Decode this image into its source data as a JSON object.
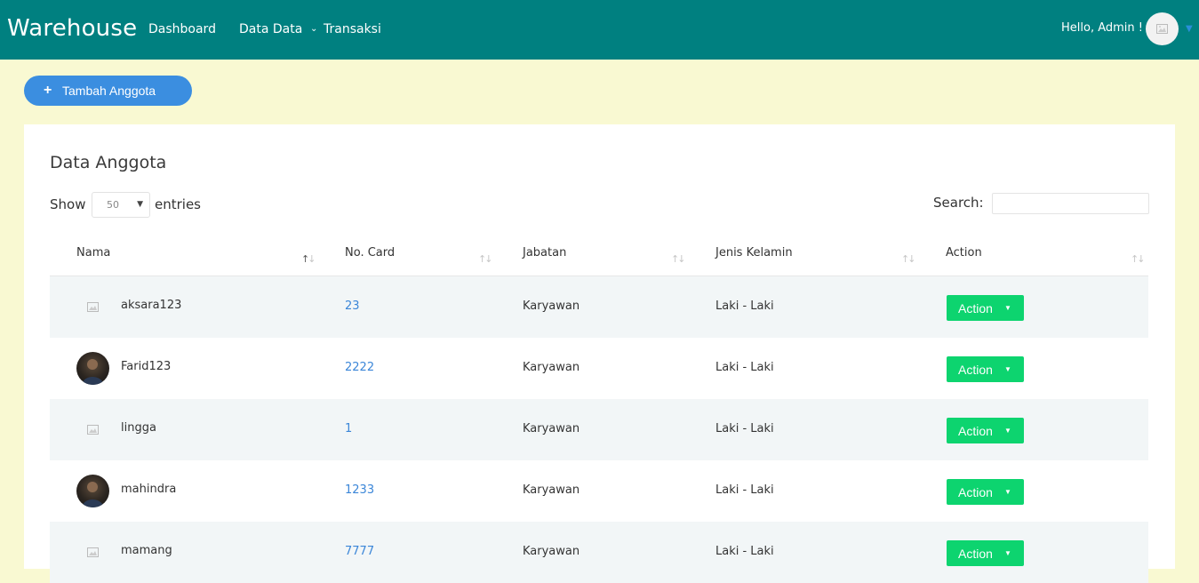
{
  "navbar": {
    "brand": "Warehouse",
    "links": [
      "Dashboard",
      "Data Data",
      "Transaksi"
    ],
    "greeting": "Hello, Admin !",
    "avatar_icon": "image-placeholder-icon",
    "bg_color": "#008080"
  },
  "toolbar": {
    "add_label": "Tambah Anggota",
    "add_icon": "plus-icon"
  },
  "card": {
    "title": "Data Anggota",
    "show_label": "Show",
    "page_size": "50",
    "entries_label": "entries",
    "search_label": "Search:",
    "search_value": ""
  },
  "table": {
    "columns": [
      "Nama",
      "No. Card",
      "Jabatan",
      "Jenis Kelamin",
      "Action"
    ],
    "sorted_column": "Nama",
    "rows": [
      {
        "nama": "aksara123",
        "card": "23",
        "jabatan": "Karyawan",
        "jk": "Laki - Laki",
        "action": "Action",
        "avatar": "image-placeholder-icon"
      },
      {
        "nama": "Farid123",
        "card": "2222",
        "jabatan": "Karyawan",
        "jk": "Laki - Laki",
        "action": "Action",
        "avatar": "user-photo"
      },
      {
        "nama": "lingga",
        "card": "1",
        "jabatan": "Karyawan",
        "jk": "Laki - Laki",
        "action": "Action",
        "avatar": "image-placeholder-icon"
      },
      {
        "nama": "mahindra",
        "card": "1233",
        "jabatan": "Karyawan",
        "jk": "Laki - Laki",
        "action": "Action",
        "avatar": "user-photo"
      },
      {
        "nama": "mamang",
        "card": "7777",
        "jabatan": "Karyawan",
        "jk": "Laki - Laki",
        "action": "Action",
        "avatar": "image-placeholder-icon"
      }
    ]
  },
  "colors": {
    "page_bg": "#f9f9d2",
    "primary": "#3b8ee0",
    "success": "#0dd46f",
    "link": "#3b86d8"
  }
}
